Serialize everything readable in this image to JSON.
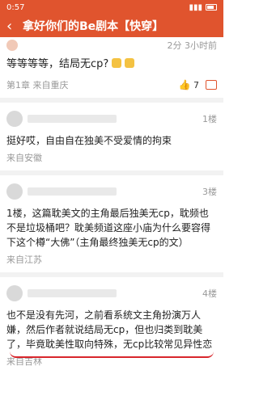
{
  "status": {
    "time": "0:57"
  },
  "header": {
    "title": "拿好你们的Be剧本【快穿】"
  },
  "post": {
    "time": "2分 3小时前",
    "title": "等等等等，结局无cp?",
    "chapter": "第1章",
    "source": "来自重庆",
    "likes": "7"
  },
  "comments": [
    {
      "floor": "1楼",
      "text": "挺好哎，自由自在独美不受爱情的拘束",
      "from": "来自安徽"
    },
    {
      "floor": "3楼",
      "text": "1楼，这篇耽美文的主角最后独美无cp，耽频也不是垃圾桶吧？耽美频道这座小庙为什么要容得下这个樽“大佛”（主角最终独美无cp的文）",
      "from": "来自江苏"
    },
    {
      "floor": "4楼",
      "text": "也不是没有先河，之前看系统文主角扮演万人嫌，然后作者就说结局无cp，但也归类到耽美了，毕竟耽美性取向特殊，无cp比较常见异性恋",
      "from": "来自吉林"
    }
  ]
}
